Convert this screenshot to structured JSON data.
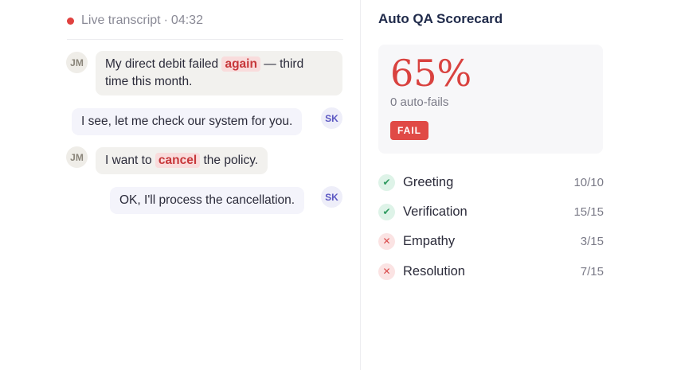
{
  "transcript": {
    "status": "Live transcript",
    "separator": "·",
    "duration": "04:32",
    "messages": [
      {
        "speaker": "JM",
        "role": "customer",
        "pre": "My direct debit failed ",
        "flag": "again",
        "post": " — third",
        "line2": "time this month."
      },
      {
        "speaker": "SK",
        "role": "agent",
        "text": "I see, let me check our system for you."
      },
      {
        "speaker": "JM",
        "role": "customer",
        "pre": "I want to ",
        "flag": "cancel",
        "post": " the policy."
      },
      {
        "speaker": "SK",
        "role": "agent",
        "text": "OK, I'll process the cancellation."
      }
    ]
  },
  "scorecard": {
    "title": "Auto QA Scorecard",
    "score": "65%",
    "auto_fails": "0 auto-fails",
    "result": "FAIL",
    "criteria": [
      {
        "label": "Greeting",
        "score": "10/10",
        "status": "pass"
      },
      {
        "label": "Verification",
        "score": "15/15",
        "status": "pass"
      },
      {
        "label": "Empathy",
        "score": "3/15",
        "status": "fail"
      },
      {
        "label": "Resolution",
        "score": "7/15",
        "status": "fail"
      }
    ]
  },
  "colors": {
    "live_dot": "#e0413f",
    "score": "#d9423f",
    "fail_badge": "#e04a46",
    "pass": "#2f9b60",
    "agent_avatar": "#5b57c2"
  },
  "icons": {
    "pass": "check-icon",
    "fail": "x-icon"
  }
}
